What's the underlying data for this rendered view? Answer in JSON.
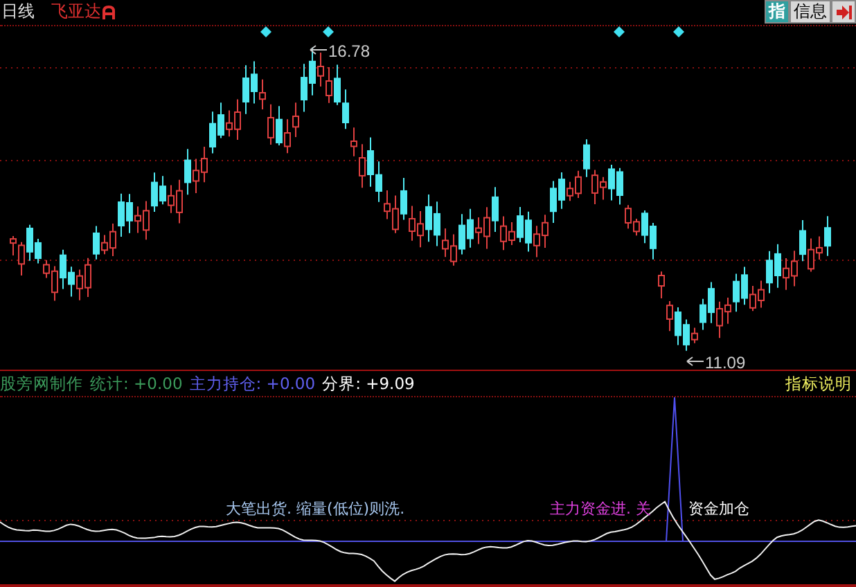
{
  "header": {
    "period": "日线",
    "stock_name": "飞亚达",
    "buttons": [
      {
        "kind": "badge",
        "label": "指"
      },
      {
        "kind": "text",
        "label": "信息"
      },
      {
        "kind": "exit"
      }
    ]
  },
  "price_chart": {
    "high_label": "16.78",
    "low_label": "11.09"
  },
  "indicator": {
    "name": "股旁网制作",
    "legend": [
      {
        "label": "统计: +0.00",
        "color": "#3c9c5c"
      },
      {
        "label": "主力持仓: +0.00",
        "color": "#6060f0"
      },
      {
        "label": "分界: +9.09",
        "color": "#ffffff"
      }
    ],
    "help_link": "指标说明",
    "annotations": [
      {
        "text": "大笔出货. 缩量(低位)则洗.",
        "color": "#a8c8f0"
      },
      {
        "text": "主力资金进. 关",
        "color": "#e040e0"
      },
      {
        "text": "资金加仓",
        "color": "#ffffff"
      }
    ]
  }
}
